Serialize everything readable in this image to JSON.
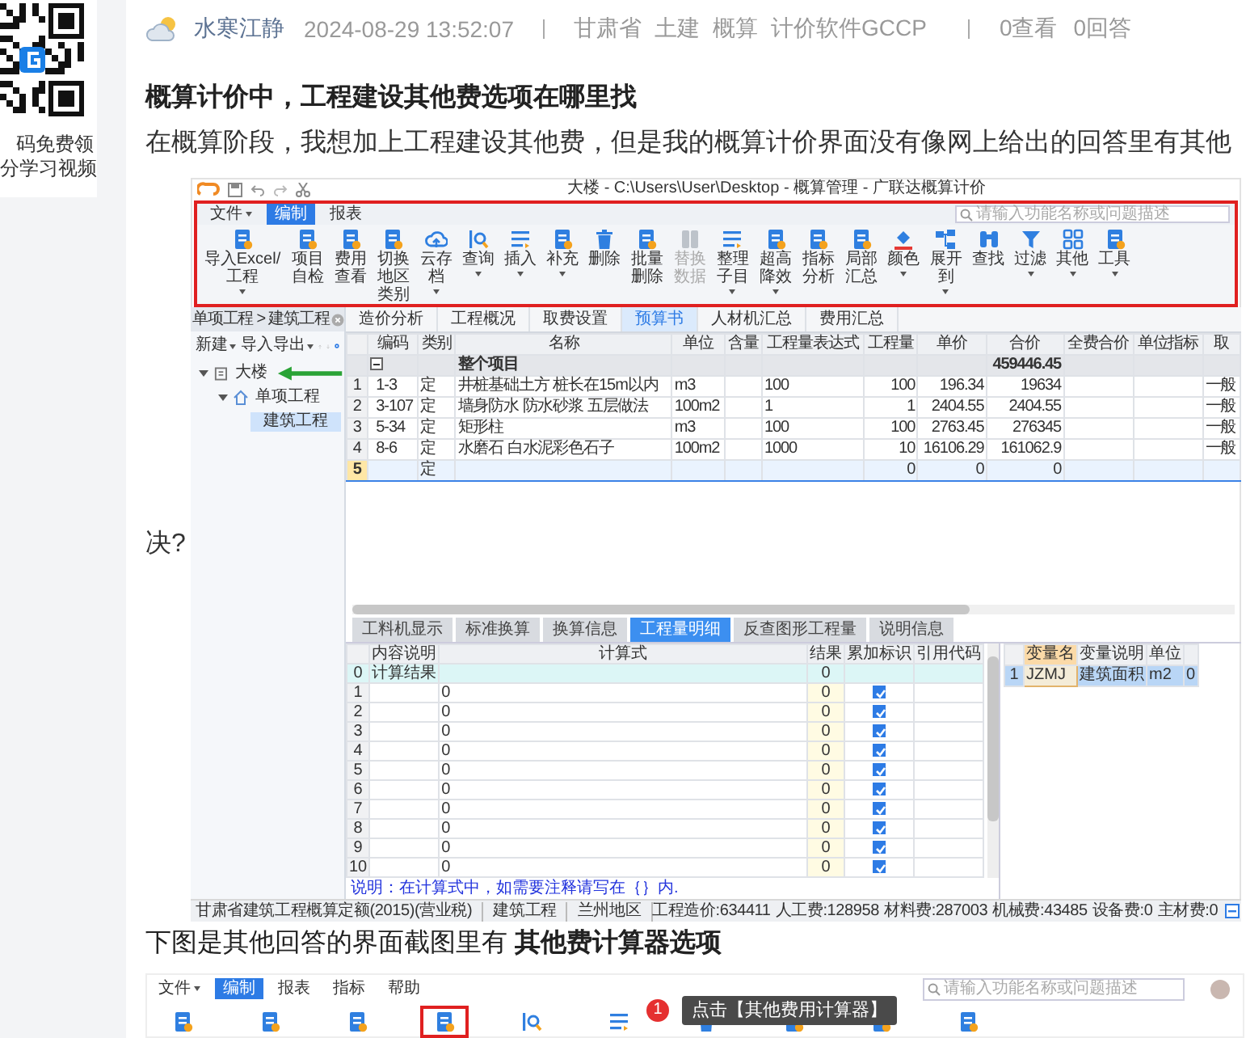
{
  "promo": {
    "lines": [
      "码免费领",
      "分学习视频"
    ]
  },
  "post": {
    "author": "水寒江静",
    "time": "2024-08-29 13:52:07",
    "tags": [
      "甘肃省",
      "土建",
      "概算",
      "计价软件GCCP"
    ],
    "stats": [
      "0查看",
      "0回答"
    ],
    "title": "概算计价中，工程建设其他费选项在哪里找",
    "body": "在概算阶段，我想加上工程建设其他费，但是我的概算计价界面没有像网上给出的回答里有其他",
    "body_continued": "决?"
  },
  "screenshot_1": {
    "title": "大楼 - C:\\Users\\User\\Desktop - 概算管理 - 广联达概算计价",
    "menu": [
      {
        "label": "文件",
        "has_menu": true,
        "selected": false
      },
      {
        "label": "编制",
        "has_menu": false,
        "selected": true
      },
      {
        "label": "报表",
        "has_menu": false,
        "selected": false
      }
    ],
    "search_placeholder": "请输入功能名称或问题描述",
    "toolbar": [
      {
        "label": "导入Excel/工程",
        "has_menu": true,
        "disabled": false
      },
      {
        "label": "项目自检",
        "has_menu": false,
        "disabled": false
      },
      {
        "label": "费用查看",
        "has_menu": false,
        "disabled": false
      },
      {
        "label": "切换地区类别",
        "has_menu": false,
        "disabled": false
      },
      {
        "label": "云存档",
        "has_menu": true,
        "disabled": false
      },
      {
        "label": "查询",
        "has_menu": true,
        "disabled": false
      },
      {
        "label": "插入",
        "has_menu": true,
        "disabled": false
      },
      {
        "label": "补充",
        "has_menu": true,
        "disabled": false
      },
      {
        "label": "删除",
        "has_menu": false,
        "disabled": false
      },
      {
        "label": "批量删除",
        "has_menu": false,
        "disabled": false
      },
      {
        "label": "替换数据",
        "has_menu": false,
        "disabled": true
      },
      {
        "label": "整理子目",
        "has_menu": true,
        "disabled": false
      },
      {
        "label": "超高降效",
        "has_menu": true,
        "disabled": false
      },
      {
        "label": "指标分析",
        "has_menu": false,
        "disabled": false
      },
      {
        "label": "局部汇总",
        "has_menu": false,
        "disabled": false
      },
      {
        "label": "颜色",
        "has_menu": true,
        "disabled": false
      },
      {
        "label": "展开到",
        "has_menu": true,
        "disabled": false
      },
      {
        "label": "查找",
        "has_menu": false,
        "disabled": false
      },
      {
        "label": "过滤",
        "has_menu": true,
        "disabled": false
      },
      {
        "label": "其他",
        "has_menu": true,
        "disabled": false
      },
      {
        "label": "工具",
        "has_menu": true,
        "disabled": false
      }
    ],
    "breadcrumb": "单项工程 > 建筑工程",
    "tree_actions": [
      {
        "label": "新建",
        "has_menu": true
      },
      {
        "label": "导入导出",
        "has_menu": true
      }
    ],
    "tree": [
      {
        "label": "大楼",
        "expanded": true,
        "selected": false,
        "children": [
          {
            "label": "单项工程",
            "expanded": true,
            "selected": false,
            "children": [
              {
                "label": "建筑工程",
                "selected": true
              }
            ]
          }
        ]
      }
    ],
    "tabs": [
      {
        "label": "造价分析",
        "selected": false
      },
      {
        "label": "工程概况",
        "selected": false
      },
      {
        "label": "取费设置",
        "selected": false
      },
      {
        "label": "预算书",
        "selected": true
      },
      {
        "label": "人材机汇总",
        "selected": false
      },
      {
        "label": "费用汇总",
        "selected": false
      }
    ],
    "table": {
      "columns": [
        "编码",
        "类别",
        "名称",
        "单位",
        "含量",
        "工程量表达式",
        "工程量",
        "单价",
        "合价",
        "全费合价",
        "单位指标",
        "取"
      ],
      "rows": [
        {
          "kind": "group",
          "expanded": true,
          "selected": false,
          "name": "整个项目",
          "total": "459446.45"
        },
        {
          "kind": "item",
          "selected": false,
          "number": "1",
          "code": "1-3",
          "type": "定",
          "name": "井桩基础土方 桩长在15m以内",
          "unit": "m3",
          "expr": "100",
          "qty": "100",
          "price": "196.34",
          "total": "19634",
          "fee": "一般"
        },
        {
          "kind": "item",
          "selected": false,
          "number": "2",
          "code": "3-107",
          "type": "定",
          "name": "墙身防水 防水砂浆 五层做法",
          "unit": "100m2",
          "expr": "1",
          "qty": "1",
          "price": "2404.55",
          "total": "2404.55",
          "fee": "一般"
        },
        {
          "kind": "item",
          "selected": false,
          "number": "3",
          "code": "5-34",
          "type": "定",
          "name": "矩形柱",
          "unit": "m3",
          "expr": "100",
          "qty": "100",
          "price": "2763.45",
          "total": "276345",
          "fee": "一般"
        },
        {
          "kind": "item",
          "selected": false,
          "number": "4",
          "code": "8-6",
          "type": "定",
          "name": "水磨石 白水泥彩色石子",
          "unit": "100m2",
          "expr": "1000",
          "qty": "10",
          "price": "16106.29",
          "total": "161062.9",
          "fee": "一般"
        },
        {
          "kind": "item",
          "selected": true,
          "number": "5",
          "type": "定",
          "qty": "0",
          "price": "0",
          "total": "0"
        }
      ]
    },
    "detail_tabs": [
      {
        "label": "工料机显示",
        "selected": false
      },
      {
        "label": "标准换算",
        "selected": false
      },
      {
        "label": "换算信息",
        "selected": false
      },
      {
        "label": "工程量明细",
        "selected": true
      },
      {
        "label": "反查图形工程量",
        "selected": false
      },
      {
        "label": "说明信息",
        "selected": false
      }
    ],
    "calc": {
      "columns": [
        "内容说明",
        "计算式",
        "结果",
        "累加标识",
        "引用代码"
      ],
      "rows": [
        {
          "kind": "total",
          "number": "0",
          "description": "计算结果",
          "result": "0"
        },
        {
          "kind": "line",
          "number": "1",
          "formula": "0",
          "result": "0",
          "accumulate": true
        },
        {
          "kind": "line",
          "number": "2",
          "formula": "0",
          "result": "0",
          "accumulate": true
        },
        {
          "kind": "line",
          "number": "3",
          "formula": "0",
          "result": "0",
          "accumulate": true
        },
        {
          "kind": "line",
          "number": "4",
          "formula": "0",
          "result": "0",
          "accumulate": true
        },
        {
          "kind": "line",
          "number": "5",
          "formula": "0",
          "result": "0",
          "accumulate": true
        },
        {
          "kind": "line",
          "number": "6",
          "formula": "0",
          "result": "0",
          "accumulate": true
        },
        {
          "kind": "line",
          "number": "7",
          "formula": "0",
          "result": "0",
          "accumulate": true
        },
        {
          "kind": "line",
          "number": "8",
          "formula": "0",
          "result": "0",
          "accumulate": true
        },
        {
          "kind": "line",
          "number": "9",
          "formula": "0",
          "result": "0",
          "accumulate": true
        },
        {
          "kind": "line",
          "number": "10",
          "formula": "0",
          "result": "0",
          "accumulate": true
        }
      ],
      "note": "说明：在计算式中，如需要注释请写在｛｝内."
    },
    "variables": {
      "columns": [
        "变量名",
        "变量说明",
        "单位"
      ],
      "rows": [
        {
          "number": "1",
          "name": "JZMJ",
          "description": "建筑面积",
          "unit": "m2",
          "value": "0",
          "selected": true
        }
      ]
    },
    "status": {
      "left": [
        "甘肃省建筑工程概算定额(2015)(营业税)",
        "建筑工程",
        "兰州地区"
      ],
      "totals": [
        "工程造价:634411",
        "人工费:128958",
        "材料费:287003",
        "机械费:43485",
        "设备费:0",
        "主材费:0"
      ]
    }
  },
  "caption": "下图是其他回答的界面截图里有 **其他费计算器选项**",
  "screenshot_2": {
    "menu": [
      {
        "label": "文件",
        "has_menu": true,
        "selected": false
      },
      {
        "label": "编制",
        "has_menu": false,
        "selected": true
      },
      {
        "label": "报表",
        "has_menu": false,
        "selected": false
      },
      {
        "label": "指标",
        "has_menu": false,
        "selected": false
      },
      {
        "label": "帮助",
        "has_menu": false,
        "selected": false
      }
    ],
    "search_placeholder": "请输入功能名称或问题描述",
    "toolbar": [
      {
        "highlighted": false
      },
      {
        "highlighted": false
      },
      {
        "highlighted": false
      },
      {
        "highlighted": true
      },
      {
        "highlighted": false
      },
      {
        "highlighted": false
      },
      {
        "highlighted": false
      },
      {
        "highlighted": false
      },
      {
        "highlighted": false
      },
      {
        "highlighted": false
      }
    ],
    "step_badge": "1",
    "tooltip": "点击【其他费用计算器】"
  }
}
